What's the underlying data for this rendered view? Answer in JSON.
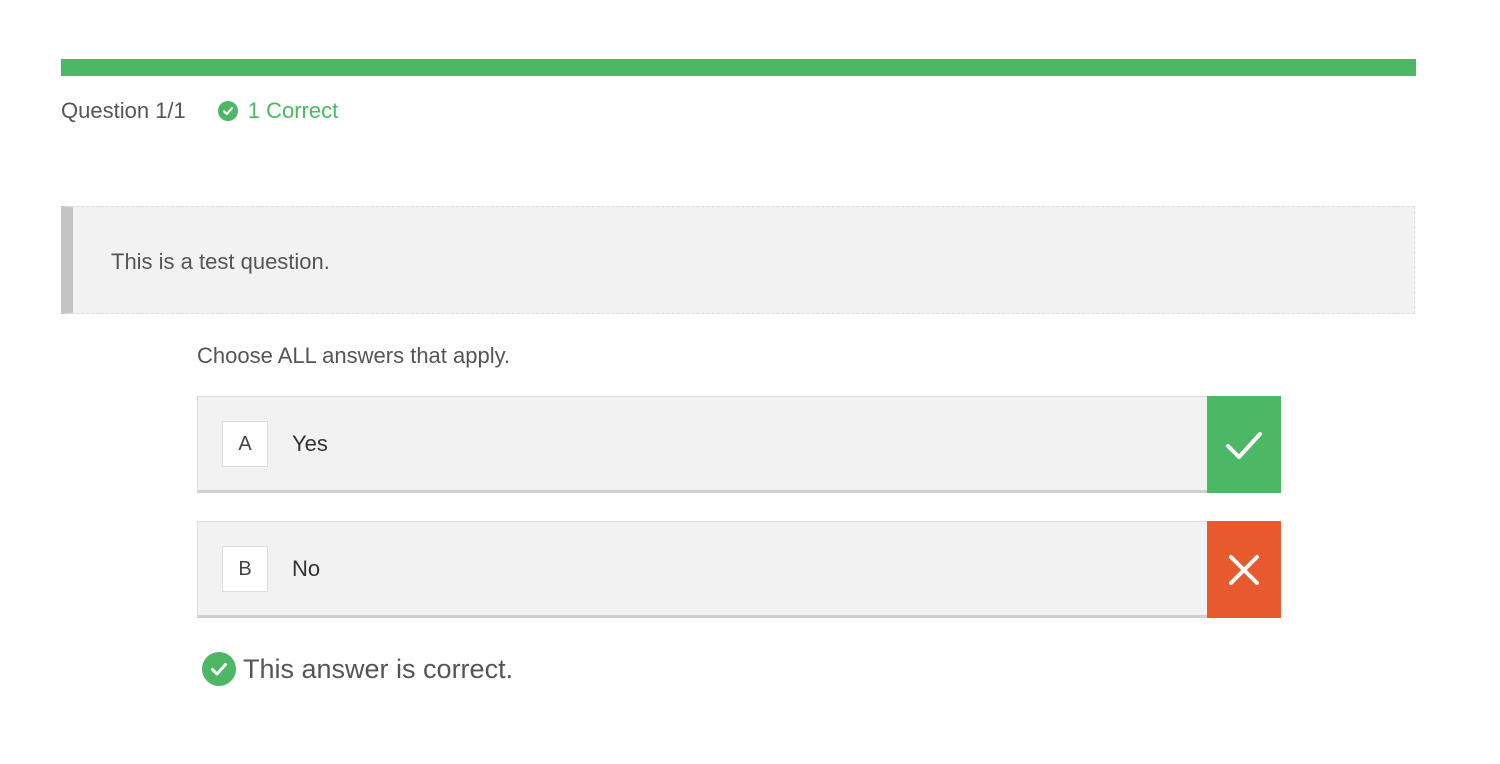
{
  "progress": {
    "fraction": 1.0,
    "color": "#4cb865"
  },
  "status": {
    "question_counter": "Question 1/1",
    "correct_icon": "check-circle-icon",
    "correct_label": "1 Correct"
  },
  "question": {
    "text": "This is a test question."
  },
  "instruction": "Choose ALL answers that apply.",
  "answers": [
    {
      "letter": "A",
      "label": "Yes",
      "result": "correct",
      "icon": "check-icon",
      "color": "#4cb865"
    },
    {
      "letter": "B",
      "label": "No",
      "result": "incorrect",
      "icon": "x-icon",
      "color": "#e65a2e"
    }
  ],
  "feedback": {
    "icon": "check-circle-icon",
    "text": "This answer is correct."
  }
}
